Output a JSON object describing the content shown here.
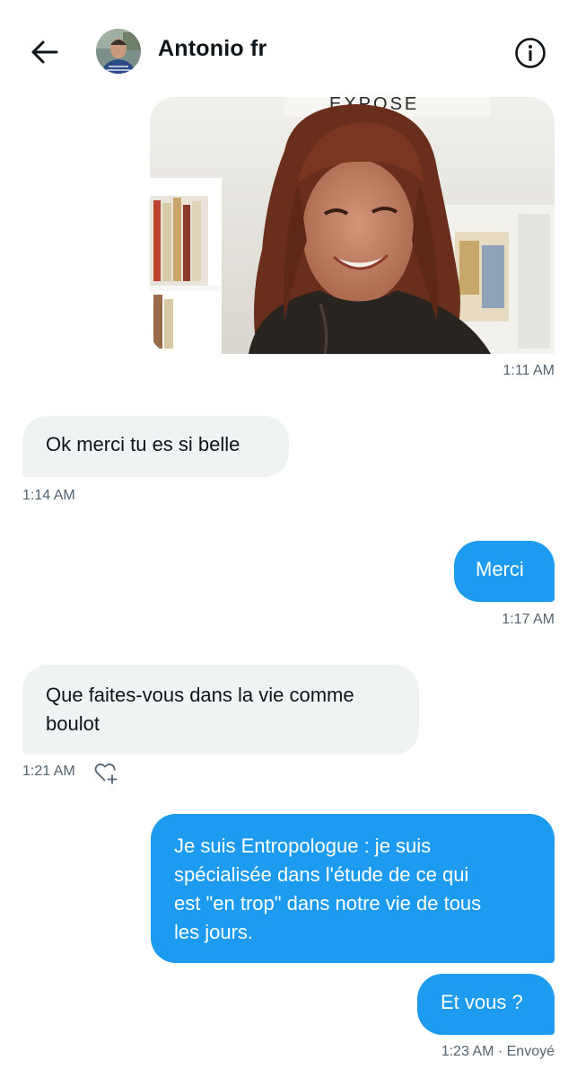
{
  "header": {
    "contact_name": "Antonio fr",
    "back_icon": "arrow-left-icon",
    "info_icon": "info-icon"
  },
  "photo": {
    "sign_text": "EXPOSE",
    "description_icon": "shared-photo"
  },
  "messages": [
    {
      "direction": "out",
      "type": "image",
      "time": "1:11 AM"
    },
    {
      "direction": "in",
      "text": "Ok merci tu es si belle",
      "time": "1:14 AM"
    },
    {
      "direction": "out",
      "text": "Merci",
      "time": "1:17 AM"
    },
    {
      "direction": "in",
      "line1": "Que faites-vous dans la vie comme",
      "line2": "boulot",
      "time": "1:21 AM"
    },
    {
      "direction": "out",
      "line1": "Je suis Entropologue : je suis",
      "line2": "spécialisée dans l'étude de ce qui",
      "line3": "est \"en trop\" dans notre vie de tous",
      "line4": "les jours."
    },
    {
      "direction": "out",
      "text": "Et vous ?",
      "time": "1:23 AM · Envoyé"
    }
  ],
  "colors": {
    "accent": "#1d9bf0",
    "incoming_bubble": "#eff3f4",
    "muted_text": "#536471"
  }
}
